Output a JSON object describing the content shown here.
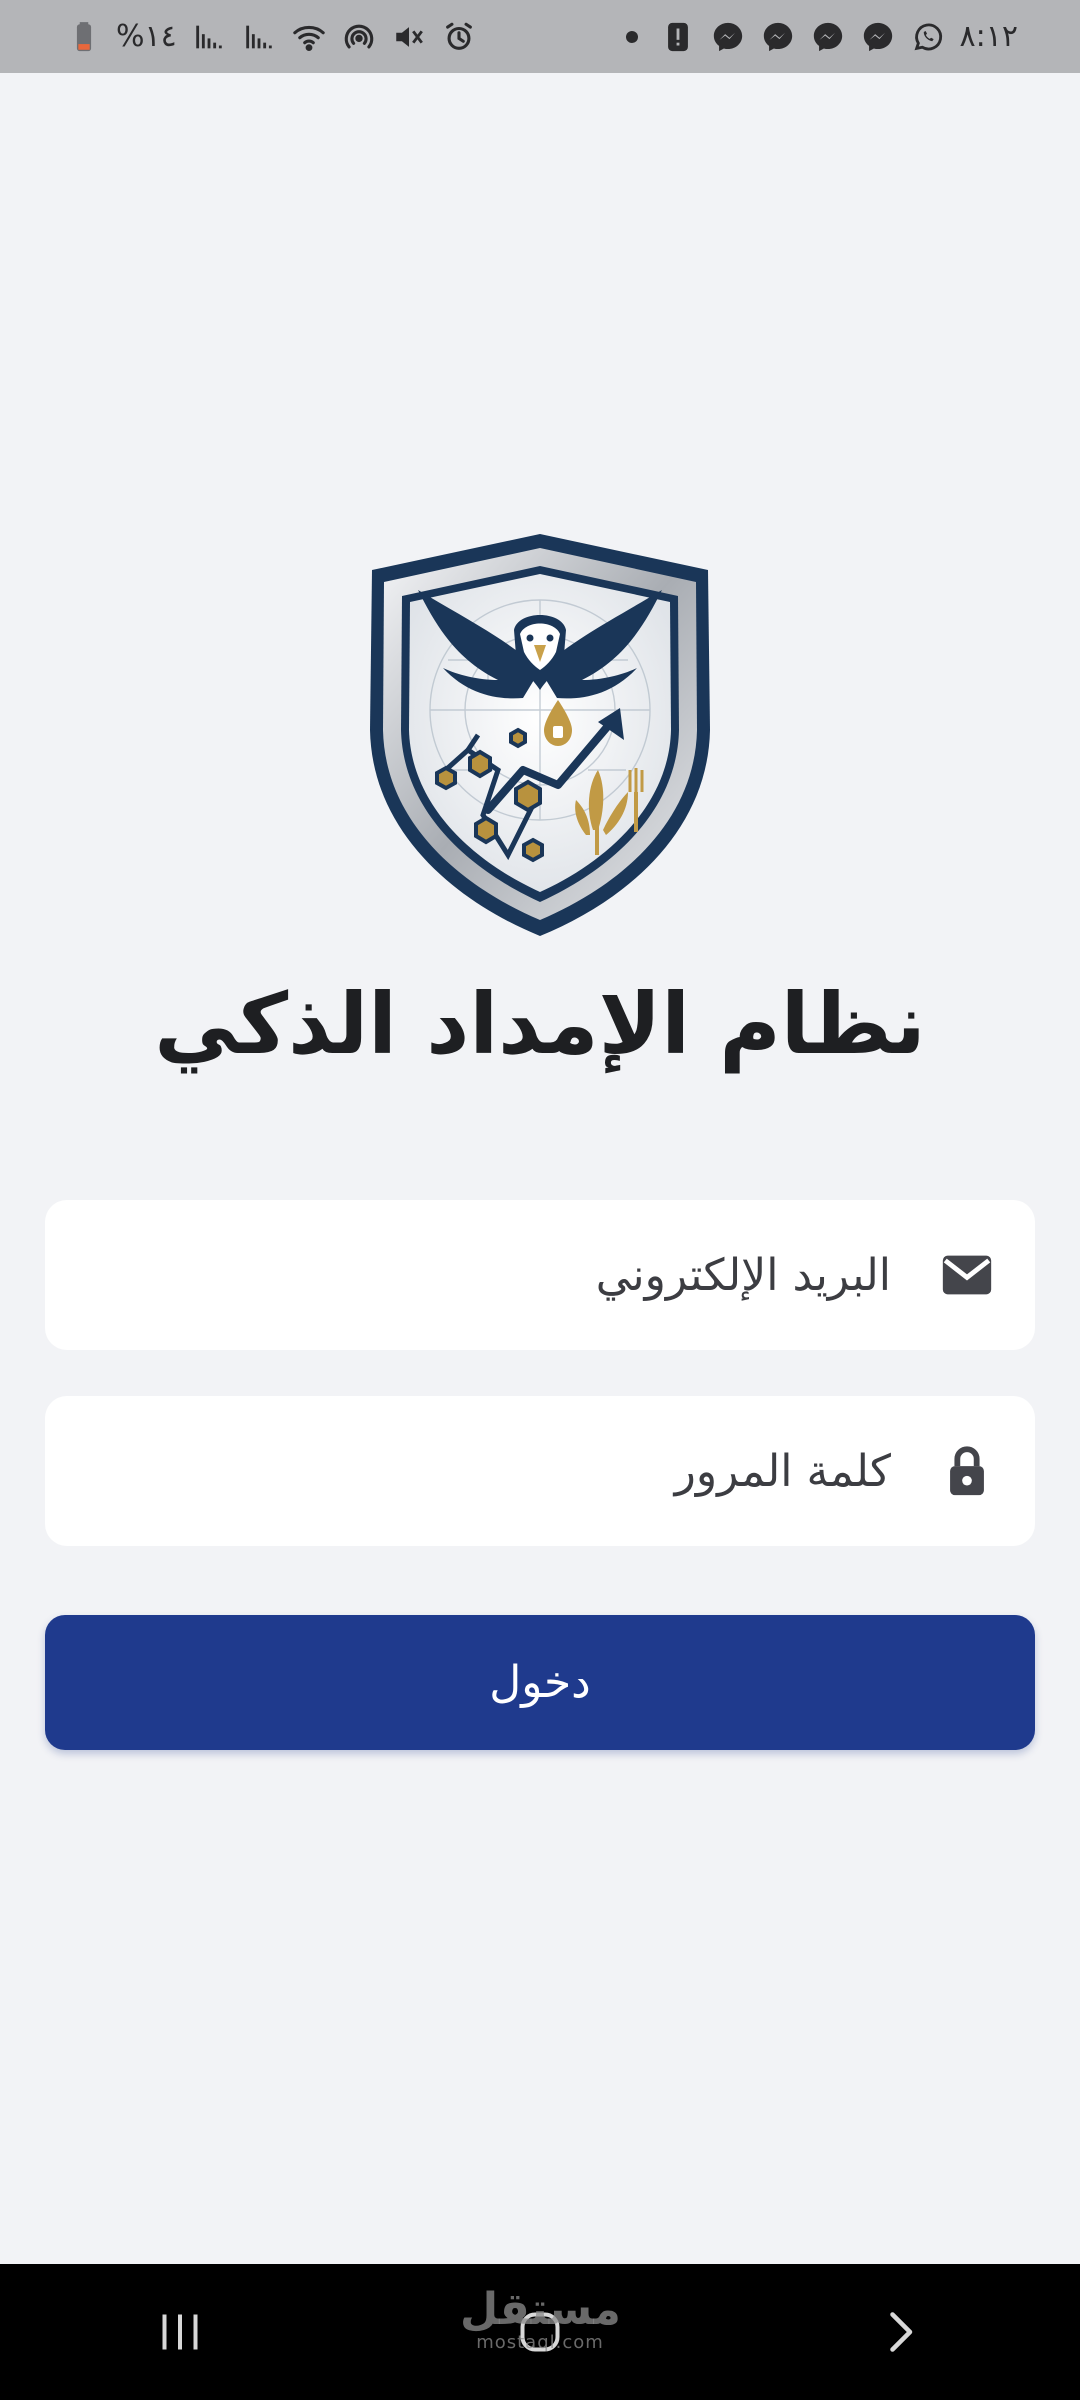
{
  "status_bar": {
    "time": "٨:١٢",
    "battery": "%١٤",
    "left_icons": [
      "battery-icon",
      "signal-icon",
      "signal-icon",
      "wifi-icon",
      "hotspot-icon",
      "mute-icon",
      "alarm-icon"
    ],
    "right_icons": [
      "dot-icon",
      "alert-icon",
      "messenger-icon",
      "messenger-icon",
      "messenger-icon",
      "messenger-icon",
      "whatsapp-icon"
    ]
  },
  "app": {
    "title": "نظام الإمداد الذكي",
    "logo": "eagle-shield-logo"
  },
  "form": {
    "email_placeholder": "البريد الإلكتروني",
    "email_value": "",
    "email_icon": "mail-icon",
    "password_placeholder": "كلمة المرور",
    "password_value": "",
    "password_icon": "lock-icon",
    "login_label": "دخول"
  },
  "colors": {
    "background": "#f2f3f6",
    "primary": "#1f3a8d",
    "status_bar": "#b4b5b8",
    "nav_bar": "#000000",
    "gold": "#b8923e",
    "navy": "#1a3658"
  },
  "nav_bar": {
    "items": [
      "recent-apps-icon",
      "home-icon",
      "back-icon"
    ]
  },
  "watermark": {
    "ar": "مستقل",
    "en": "mostaql.com"
  }
}
